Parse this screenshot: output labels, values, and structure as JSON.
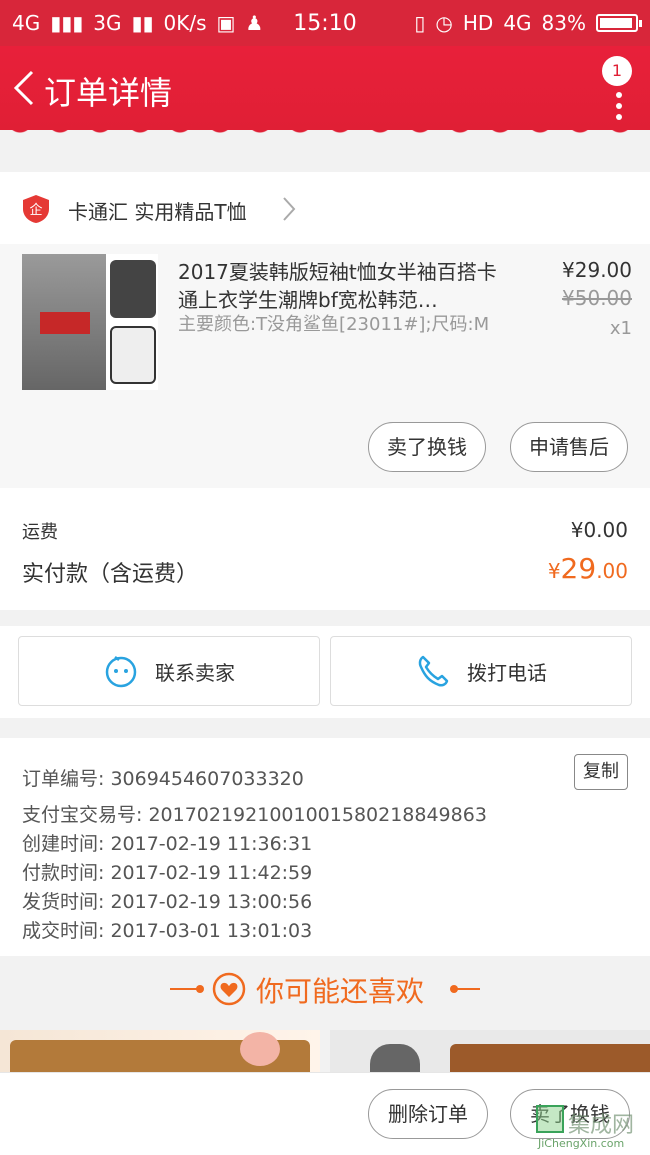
{
  "status_bar": {
    "network1": "4G",
    "network2": "3G",
    "speed": "0K/s",
    "time": "15:10",
    "hd": "HD",
    "network3": "4G",
    "battery": "83%",
    "battery_level": 0.83
  },
  "header": {
    "title": "订单详情",
    "notification_count": "1"
  },
  "shop": {
    "name": "卡通汇 实用精品T恤"
  },
  "item": {
    "title": "2017夏装韩版短袖t恤女半袖百搭卡通上衣学生潮牌bf宽松韩范…",
    "sku": "主要颜色:T没角鲨鱼[23011#];尺码:M",
    "price_now": "¥29.00",
    "price_old": "¥50.00",
    "quantity": "x1",
    "btn_sell": "卖了换钱",
    "btn_aftersale": "申请售后"
  },
  "fees": {
    "shipping_label": "运费",
    "shipping_value": "¥0.00",
    "total_label": "实付款（含运费）",
    "total_currency": "¥",
    "total_int": "29",
    "total_dec": ".00"
  },
  "contact": {
    "seller_label": "联系卖家",
    "phone_label": "拨打电话"
  },
  "order_info": {
    "order_no": "订单编号: 3069454607033320",
    "copy_label": "复制",
    "alipay_no": "支付宝交易号: 2017021921001001580218849863",
    "created": "创建时间: 2017-02-19 11:36:31",
    "paid": "付款时间: 2017-02-19 11:42:59",
    "shipped": "发货时间: 2017-02-19 13:00:56",
    "completed": "成交时间: 2017-03-01 13:01:03"
  },
  "recommend": {
    "title": "你可能还喜欢"
  },
  "bottom": {
    "delete_label": "删除订单",
    "sell_label": "卖了换钱"
  },
  "watermark": {
    "text": "集成网",
    "url": "JiChengXin.com"
  },
  "colors": {
    "brand_red": "#e01f35",
    "price_orange": "#f06a1f"
  }
}
